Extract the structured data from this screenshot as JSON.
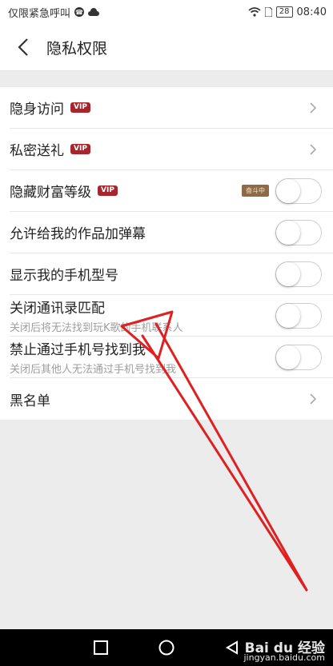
{
  "status_bar": {
    "left_text": "仅限紧急呼叫",
    "battery": "28",
    "time": "08:40"
  },
  "header": {
    "title": "隐私权限",
    "back_icon": "chevron-left-icon"
  },
  "settings": [
    {
      "label": "隐身访问",
      "vip": "VIP",
      "control": "chevron"
    },
    {
      "label": "私密送礼",
      "vip": "VIP",
      "control": "chevron"
    },
    {
      "label": "隐藏财富等级",
      "vip": "VIP",
      "badge": "奋斗中",
      "control": "toggle",
      "enabled": false
    },
    {
      "label": "允许给我的作品加弹幕",
      "control": "toggle",
      "enabled": false
    },
    {
      "label": "显示我的手机型号",
      "control": "toggle",
      "enabled": false
    },
    {
      "label": "关闭通讯录匹配",
      "sub": "关闭后将无法找到玩K歌的手机联系人",
      "control": "toggle",
      "enabled": false
    },
    {
      "label": "禁止通过手机号找到我",
      "sub": "关闭后其他人无法通过手机号找到我",
      "control": "toggle",
      "enabled": false
    },
    {
      "label": "黑名单",
      "control": "chevron"
    }
  ],
  "watermark": {
    "brand": "Bai du 经验",
    "site": "jingyan.baidu.com"
  },
  "colors": {
    "vip_badge": "#a7262d",
    "annotation_arrow": "#e02020",
    "rank_badge": "#8e6a46"
  }
}
